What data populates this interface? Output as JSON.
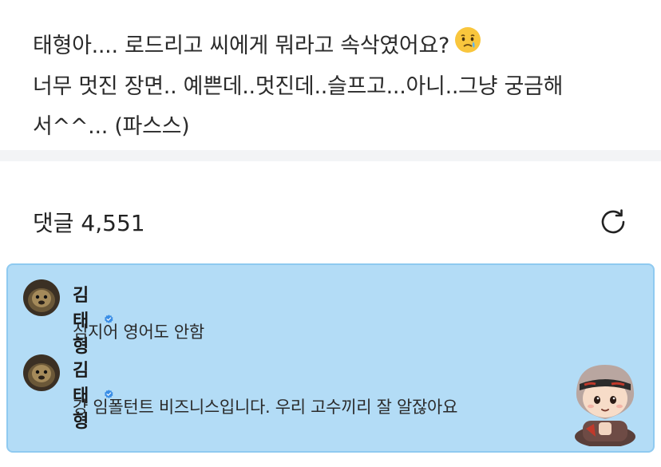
{
  "post": {
    "lines": [
      "태형아.... 로드리고 씨에게 뭐라고 속삭였어요?",
      "너무 멋진 장면.. 예쁜데..멋진데..슬프고...아니..그냥 궁금해",
      "서^^... (파스스)"
    ],
    "emoji_icon": "crying-face-emoji"
  },
  "comments_section": {
    "title": "댓글 4,551",
    "refresh_icon": "refresh-icon"
  },
  "highlight": {
    "background": "#b3dcf6",
    "border": "#8fcaf0",
    "comments": [
      {
        "author": "김태형",
        "verified": true,
        "text": "심지어 영어도 안함"
      },
      {
        "author": "김태형",
        "verified": true,
        "text": "걍 임폴턴트 비즈니스입니다. 우리 고수끼리 잘 알잖아요"
      }
    ],
    "sticker_icon": "character-sticker-icon"
  },
  "colors": {
    "verified_badge": "#3a8ee6",
    "divider": "#f3f4f6"
  }
}
